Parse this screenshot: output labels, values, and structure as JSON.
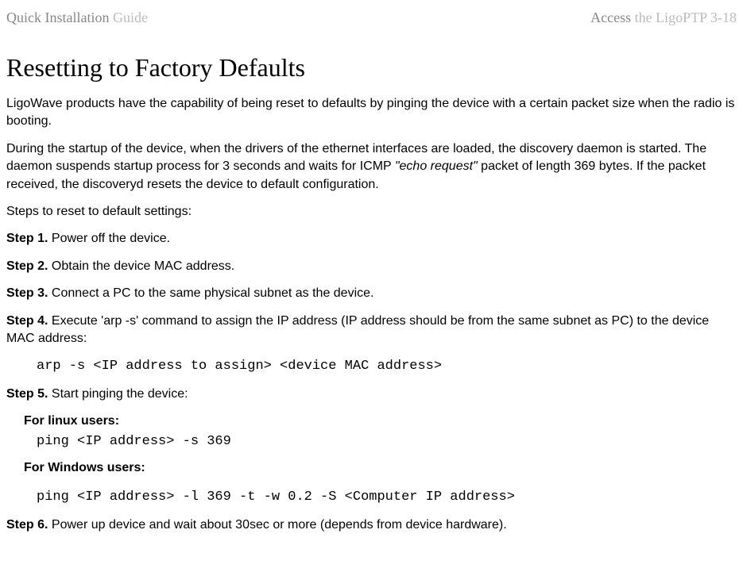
{
  "header": {
    "left_dark": "Quick Installation",
    "left_light": " Guide",
    "right_dark": "Access",
    "right_light": " the LigoPTP 3-18"
  },
  "title": "Resetting to Factory Defaults",
  "para1": "LigoWave products have the capability of being reset to defaults by pinging the device with a certain packet size when the radio is booting.",
  "para2a": "During the startup of the device, when the drivers of the ethernet interfaces are loaded, the discovery daemon is started. The daemon suspends startup process for 3 seconds and waits for ICMP ",
  "para2b": "\"echo request\"",
  "para2c": " packet of length 369 bytes. If the packet received, the discoveryd resets the device to default configuration.",
  "para3": "Steps to reset to default settings:",
  "step1_label": "Step 1.",
  "step1_text": " Power off the device.",
  "step2_label": "Step 2.",
  "step2_text": " Obtain the device MAC address.",
  "step3_label": "Step 3.",
  "step3_text": " Connect a PC to the same physical subnet as the device.",
  "step4_label": "Step 4.",
  "step4_text": " Execute 'arp -s' command to assign the IP address (IP address should be from the same subnet as PC) to the device MAC address:",
  "step4_code": "arp -s <IP address to assign> <device MAC address>",
  "step5_label": "Step 5.",
  "step5_text": " Start pinging the device:",
  "linux_label": "For linux users:",
  "linux_code": "ping <IP address> -s 369",
  "windows_label": "For Windows users:",
  "windows_code": "ping <IP address> -l 369 -t -w 0.2 -S <Computer IP address>",
  "step6_label": "Step 6.",
  "step6_text": " Power up device and wait about 30sec or more (depends from device hardware)."
}
